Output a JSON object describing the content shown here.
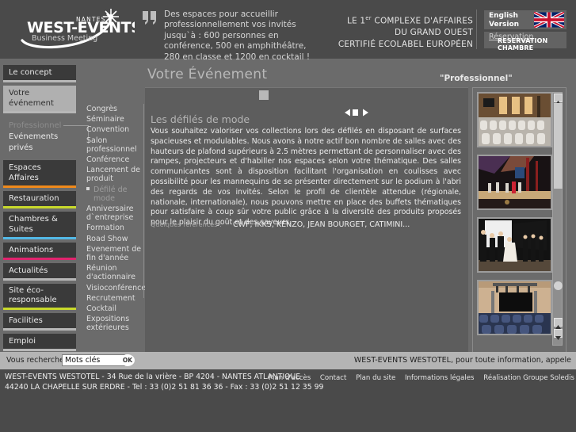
{
  "header": {
    "logo": {
      "brand": "WEST-EVENTS",
      "city": "NANTES",
      "tagline": "Business Meeting"
    },
    "quote_icon": "quote-mark-icon",
    "quote": "Des espaces pour accueillir professionnellement vos invités jusqu`à : 600 personnes en conférence, 500 en amphithéâtre, 280 en classe et 1200 en cocktail !",
    "slogan_line1_pre": "LE 1",
    "slogan_line1_sup": "er",
    "slogan_line1_post": " COMPLEXE D'AFFAIRES",
    "slogan_line2": "DU GRAND OUEST",
    "slogan_line3": "CERTIFIÉ ECOLABEL EUROPÉEN",
    "language_button": "English\nVersion",
    "language_label_line1": "English",
    "language_label_line2": "Version",
    "flag_icon": "union-jack-flag-icon",
    "reservation_link": "Réservation",
    "reservation_overlay": "RESERVATION CHAMBRE"
  },
  "leftnav": {
    "items": [
      {
        "label": "Le concept",
        "selected": false,
        "accent": "g"
      },
      {
        "label": "Votre événement",
        "selected": true,
        "accent": "g"
      },
      {
        "label": "Espaces Affaires",
        "selected": false,
        "accent": "o"
      },
      {
        "label": "Restauration",
        "selected": false,
        "accent": "y"
      },
      {
        "label": "Chambres & Suites",
        "selected": false,
        "accent": "b"
      },
      {
        "label": "Animations",
        "selected": false,
        "accent": "p"
      },
      {
        "label": "Actualités",
        "selected": false,
        "accent": "g"
      },
      {
        "label": "Site éco-responsable",
        "selected": false,
        "accent": "lg"
      },
      {
        "label": "Facilities",
        "selected": false,
        "accent": "g"
      },
      {
        "label": "Emploi",
        "selected": false,
        "accent": "g"
      }
    ],
    "accent_colors": {
      "o": "#f08a1b",
      "y": "#c8d92b",
      "b": "#53b8e6",
      "p": "#e0246e",
      "lg": "#c8d92b",
      "g": "#b7b7b7"
    },
    "type_professionnel": "Professionnel",
    "type_prives": "Evénements privés"
  },
  "submenu": {
    "items": [
      {
        "label": "Congrès",
        "active": false
      },
      {
        "label": "Séminaire",
        "active": false
      },
      {
        "label": "Convention",
        "active": false
      },
      {
        "label": "Salon professionnel",
        "active": false
      },
      {
        "label": "Conférence",
        "active": false
      },
      {
        "label": "Lancement de produit",
        "active": false
      },
      {
        "label": "Défilé de mode",
        "active": true
      },
      {
        "label": "Anniversaire d`entreprise",
        "active": false
      },
      {
        "label": "Formation",
        "active": false
      },
      {
        "label": "Road Show",
        "active": false
      },
      {
        "label": "Evenement de fin d'année",
        "active": false
      },
      {
        "label": "Réunion d'actionnaire",
        "active": false
      },
      {
        "label": "Visioconférence",
        "active": false
      },
      {
        "label": "Recrutement",
        "active": false
      },
      {
        "label": "Cocktail",
        "active": false
      },
      {
        "label": "Expositions extérieures",
        "active": false
      }
    ]
  },
  "main": {
    "page_title": "Votre Événement",
    "category_tag": "\"Professionnel\"",
    "section_title": "Les défilés de mode",
    "body": "Vous souhaitez valoriser vos collections lors des défilés en disposant de surfaces spacieuses et modulables. Nous avons à notre actif bon nombre de salles avec des hauteurs de plafond supérieurs à 2.5 mètres permettant de personnaliser avec des rampes, projecteurs et d'habiller nos espaces selon votre thématique. Des salles communicantes sont à disposition facilitant l'organisation en coulisses avec possibilité pour les mannequins de se présenter directement sur le podium à l'abri des regards de vos invités. Selon le profil de clientèle attendue (régionale, nationale, internationale), nous pouvons mettre en place des buffets thématiques pour satisfaire à coup sûr votre public grâce à la diversité des produits proposés pour le plaisir du goût et des saveurs.",
    "refs_label": "Quelques références :",
    "refs_value": "CWF, IKKS, KENZO, JEAN BOURGET, CATIMINI...",
    "slider_prev_icon": "slider-prev-arrow-icon",
    "slider_stop_icon": "slider-stop-icon",
    "slider_next_icon": "slider-next-arrow-icon"
  },
  "gallery": {
    "thumbs": [
      {
        "name": "thumb-conference-room-chairs"
      },
      {
        "name": "thumb-fashion-show-runway"
      },
      {
        "name": "thumb-stage-models"
      },
      {
        "name": "thumb-auditorium-blue-seats"
      }
    ],
    "scroll_up_icon": "scroll-up-arrow-icon",
    "scroll_down_icon": "scroll-down-arrow-icon"
  },
  "search": {
    "label": "Vous recherchez",
    "placeholder": "Mots clés",
    "value": "Mots clés",
    "ok_label": "OK",
    "info": "WEST-EVENTS WESTOTEL, pour toute information, appele"
  },
  "footer": {
    "address_line1": "WEST-EVENTS WESTOTEL - 34 Rue de la vrière - BP 4204 - NANTES ATLANTIQUE",
    "address_line2": "44240 LA CHAPELLE SUR ERDRE - Tel : 33 (0)2 51 81 36 36 - Fax : 33 (0)2 51 12 35 99",
    "links": [
      "Plan d'accès",
      "Contact",
      "Plan du site",
      "Informations légales",
      "Réalisation Groupe Soledis"
    ]
  }
}
